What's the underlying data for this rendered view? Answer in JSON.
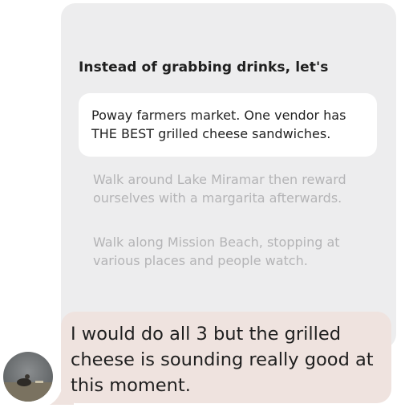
{
  "prompt": {
    "heading": "Instead of grabbing drinks, let's",
    "options": [
      {
        "text": "Poway farmers market. One vendor has THE BEST grilled cheese sandwiches.",
        "selected": true
      },
      {
        "text": "Walk around Lake Miramar then reward ourselves with a margarita afterwards.",
        "selected": false
      },
      {
        "text": "Walk along Mission Beach, stopping at various places and people watch.",
        "selected": false
      }
    ]
  },
  "reply": {
    "text": "I would do all 3 but the grilled cheese is sounding really good at this moment."
  },
  "colors": {
    "card_background": "#ededee",
    "reply_background": "#efe3df",
    "muted_text": "#b4b4b6"
  }
}
